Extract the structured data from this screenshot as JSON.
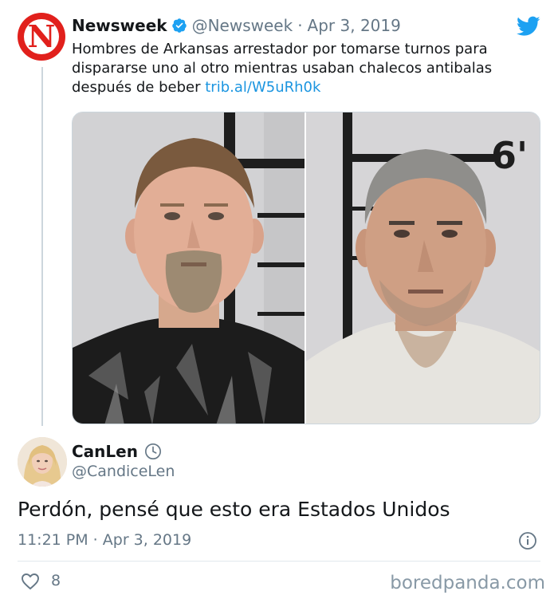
{
  "parent_tweet": {
    "author_name": "Newsweek",
    "author_handle": "@Newsweek",
    "separator": "·",
    "date": "Apr 3, 2019",
    "text": "Hombres de Arkansas arrestador por tomarse turnos para dispararse uno al otro mientras usaban chalecos antibalas después de beber",
    "link": "trib.al/W5uRh0k",
    "logo_letter": "N",
    "height_marker": "6'"
  },
  "reply_tweet": {
    "author_name": "CanLen",
    "author_handle": "@CandiceLen",
    "text": "Perdón, pensé que esto era Estados Unidos",
    "timestamp": "11:21 PM · Apr 3, 2019",
    "like_count": "8"
  },
  "watermark": "boredpanda.com",
  "colors": {
    "link": "#1b95e0",
    "brand_red": "#e1201c",
    "muted_text": "#657786",
    "twitter_blue": "#1da1f2"
  },
  "icons": [
    "verified-badge-icon",
    "twitter-bird-icon",
    "clock-icon",
    "info-icon",
    "heart-icon"
  ]
}
